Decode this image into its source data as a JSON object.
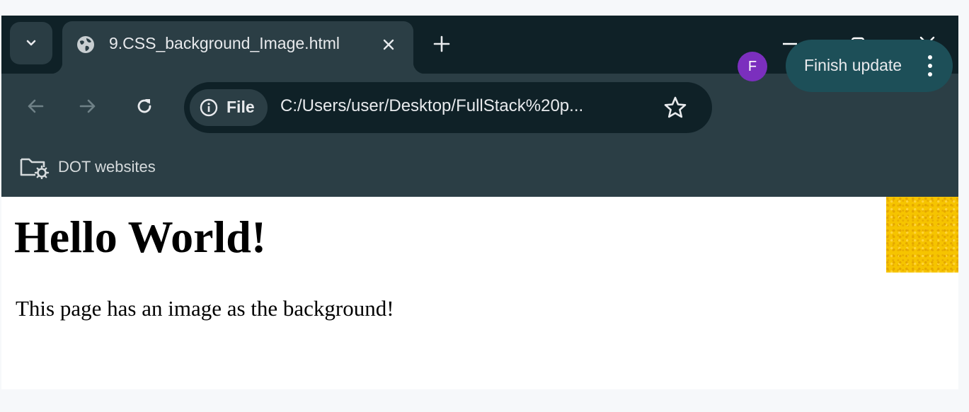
{
  "browser": {
    "tab": {
      "title": "9.CSS_background_Image.html",
      "favicon_icon": "globe-icon",
      "close_icon": "close-icon"
    },
    "toolbar": {
      "site_chip_label": "File",
      "site_chip_icon": "info-icon",
      "url": "C:/Users/user/Desktop/FullStack%20p...",
      "profile_initial": "F",
      "update_label": "Finish update"
    },
    "bookmarks": [
      {
        "label": "DOT websites",
        "icon": "managed-folder-icon"
      }
    ],
    "colors": {
      "frame": "#0f2127",
      "toolbar": "#2b3e45",
      "update_button": "#1d4f58",
      "avatar": "#7b2fbe"
    }
  },
  "page": {
    "heading": "Hello World!",
    "paragraph": "This page has an image as the background!",
    "background_tile_color": "#f6c400"
  }
}
